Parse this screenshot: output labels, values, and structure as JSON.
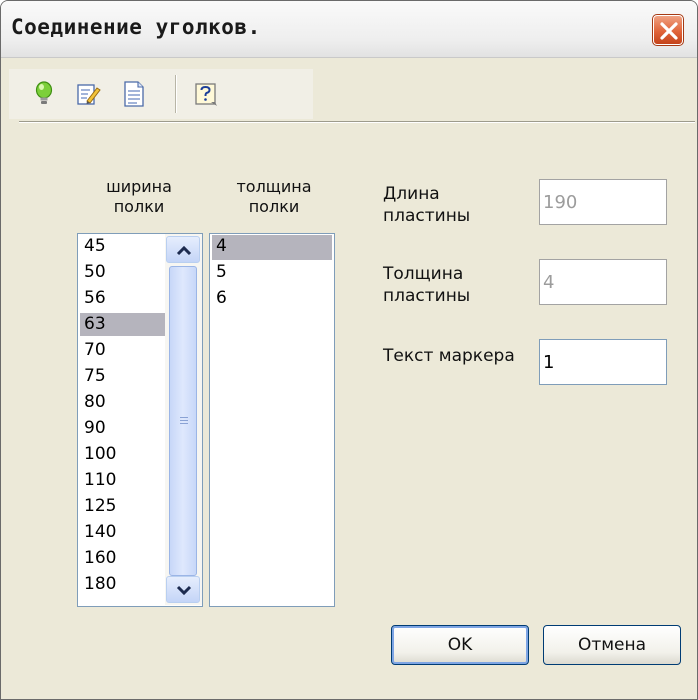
{
  "window": {
    "title": "Соединение уголков."
  },
  "toolbar": {
    "buttons": [
      {
        "icon": "lightbulb-icon"
      },
      {
        "icon": "edit-document-icon"
      },
      {
        "icon": "document-icon"
      },
      {
        "icon": "help-icon"
      }
    ]
  },
  "shelf_width": {
    "header": "ширина\nполки",
    "items": [
      "45",
      "50",
      "56",
      "63",
      "70",
      "75",
      "80",
      "90",
      "100",
      "110",
      "125",
      "140",
      "160",
      "180"
    ],
    "selected": "63"
  },
  "shelf_thickness": {
    "header": "толщина\nполки",
    "items": [
      "4",
      "5",
      "6"
    ],
    "selected": "4"
  },
  "fields": {
    "plate_length": {
      "label": "Длина\nпластины",
      "value": "190",
      "enabled": false
    },
    "plate_thickness": {
      "label": "Толщина\nпластины",
      "value": "4",
      "enabled": false
    },
    "marker_text": {
      "label": "Текст маркера",
      "value": "1",
      "enabled": true
    }
  },
  "buttons": {
    "ok": "OK",
    "cancel": "Отмена"
  },
  "colors": {
    "selection": "#b5b4bd",
    "dialog_bg": "#ece9d8",
    "close_button": "#e0643a"
  }
}
